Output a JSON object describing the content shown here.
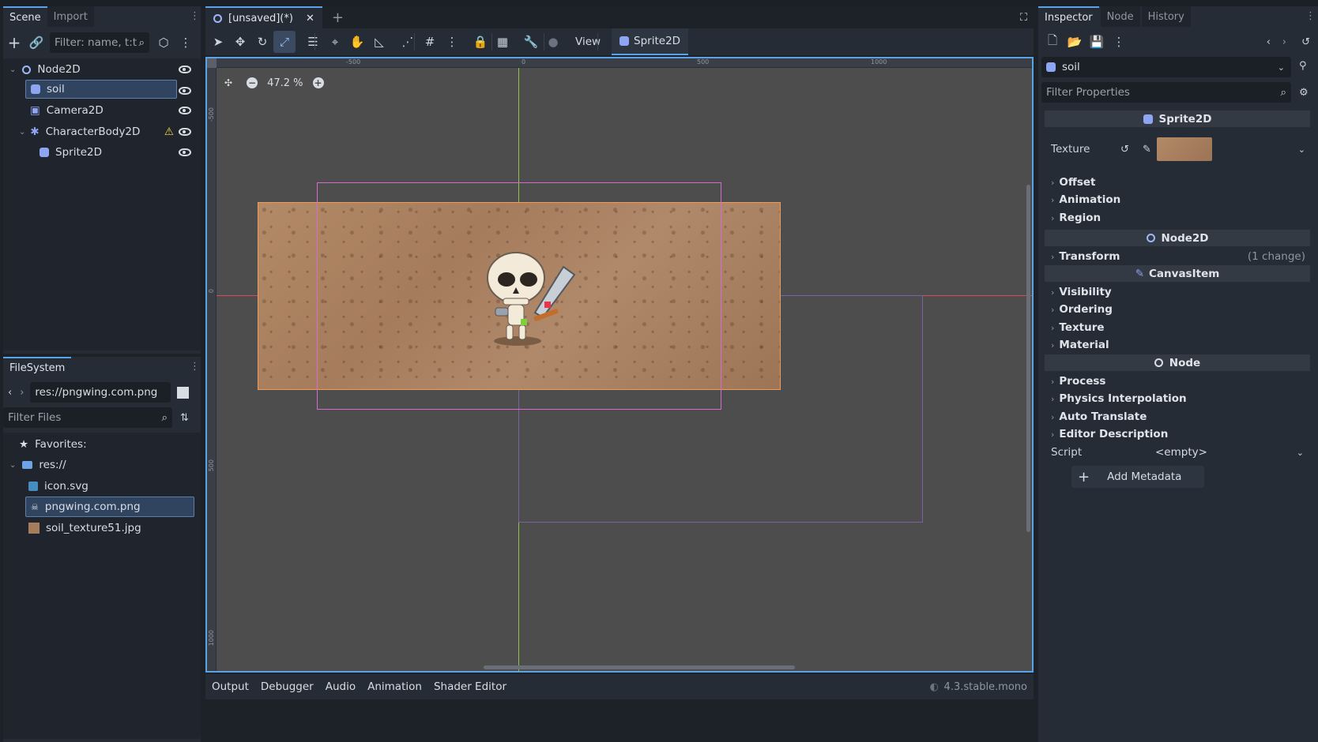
{
  "scene_dock": {
    "tabs": [
      "Scene",
      "Import"
    ],
    "filter_placeholder": "Filter: name, t:t",
    "tree": [
      {
        "label": "Node2D"
      },
      {
        "label": "soil"
      },
      {
        "label": "Camera2D"
      },
      {
        "label": "CharacterBody2D"
      },
      {
        "label": "Sprite2D"
      }
    ]
  },
  "filesystem": {
    "tab": "FileSystem",
    "path": "res://pngwing.com.png",
    "filter_placeholder": "Filter Files",
    "favorites": "Favorites:",
    "root": "res://",
    "files": [
      "icon.svg",
      "pngwing.com.png",
      "soil_texture51.jpg"
    ]
  },
  "editor": {
    "scene_tab": "[unsaved](*)",
    "toolbar": {
      "view": "View",
      "sprite_tab": "Sprite2D"
    },
    "zoom": "47.2 %",
    "ruler_h": [
      "-500",
      "0",
      "500",
      "1000"
    ],
    "ruler_v": [
      "-500",
      "0",
      "500",
      "1000"
    ]
  },
  "bottom_panel": {
    "tabs": [
      "Output",
      "Debugger",
      "Audio",
      "Animation",
      "Shader Editor"
    ],
    "version": "4.3.stable.mono"
  },
  "inspector": {
    "tabs": [
      "Inspector",
      "Node",
      "History"
    ],
    "object_name": "soil",
    "filter_placeholder": "Filter Properties",
    "class_header": "Sprite2D",
    "texture_label": "Texture",
    "sprite_groups": [
      "Offset",
      "Animation",
      "Region"
    ],
    "node2d_header": "Node2D",
    "transform": {
      "label": "Transform",
      "note": "(1 change)"
    },
    "canvas_header": "CanvasItem",
    "canvas_groups": [
      "Visibility",
      "Ordering",
      "Texture",
      "Material"
    ],
    "node_header": "Node",
    "node_groups": [
      "Process",
      "Physics Interpolation",
      "Auto Translate",
      "Editor Description"
    ],
    "script": {
      "label": "Script",
      "value": "<empty>"
    },
    "add_metadata": "Add Metadata"
  },
  "colors": {
    "accent": "#5aa3e8",
    "selection": "#30445f",
    "soil": "#a57c5c",
    "warning": "#f5d547"
  }
}
